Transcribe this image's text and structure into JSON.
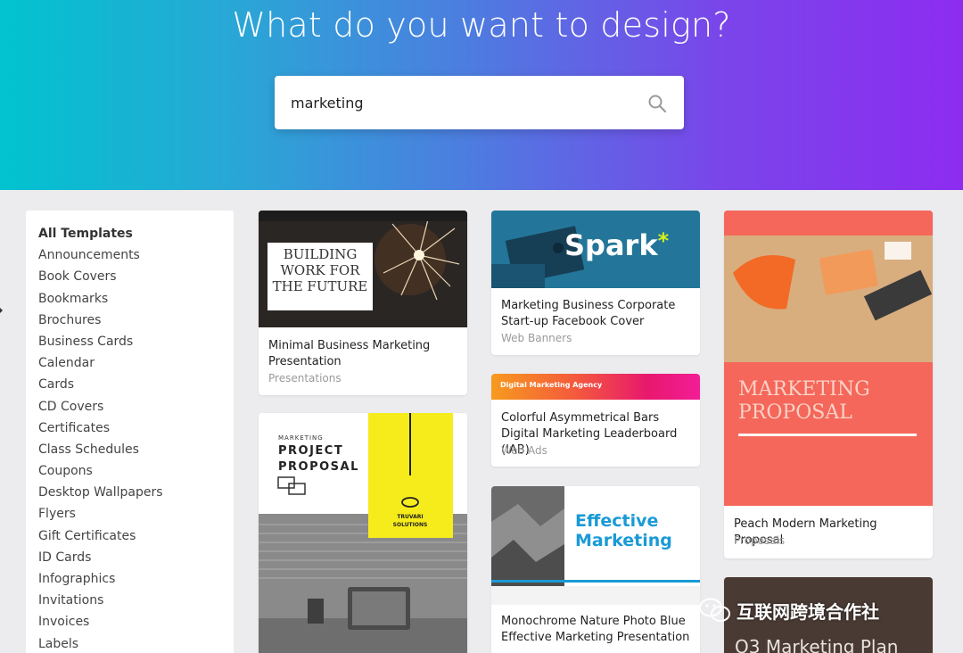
{
  "hero": {
    "title": "What do you want to design?"
  },
  "search": {
    "value": "marketing"
  },
  "sidebar": {
    "items": [
      {
        "label": "All Templates",
        "active": true
      },
      {
        "label": "Announcements"
      },
      {
        "label": "Book Covers"
      },
      {
        "label": "Bookmarks"
      },
      {
        "label": "Brochures"
      },
      {
        "label": "Business Cards"
      },
      {
        "label": "Calendar"
      },
      {
        "label": "Cards"
      },
      {
        "label": "CD Covers"
      },
      {
        "label": "Certificates"
      },
      {
        "label": "Class Schedules"
      },
      {
        "label": "Coupons"
      },
      {
        "label": "Desktop Wallpapers"
      },
      {
        "label": "Flyers"
      },
      {
        "label": "Gift Certificates"
      },
      {
        "label": "ID Cards"
      },
      {
        "label": "Infographics"
      },
      {
        "label": "Invitations"
      },
      {
        "label": "Invoices"
      },
      {
        "label": "Labels"
      }
    ]
  },
  "templates": {
    "minimal": {
      "title": "Minimal Business Marketing Presentation",
      "category": "Presentations",
      "thumb_text": "BUILDING WORK FOR THE FUTURE"
    },
    "project": {
      "thumb_kicker": "MARKETING",
      "thumb_title": "PROJECT PROPOSAL",
      "thumb_brand": "TRUVARI SOLUTIONS"
    },
    "spark": {
      "title": "Marketing Business Corporate Start-up Facebook Cover",
      "category": "Web Banners",
      "thumb_text": "Spark",
      "thumb_star": "*"
    },
    "colorful": {
      "title": "Colorful Asymmetrical Bars Digital Marketing Leaderboard (IAB)",
      "category": "Web Ads",
      "thumb_text": "Digital Marketing Agency"
    },
    "effective": {
      "title": "Monochrome Nature Photo Blue Effective Marketing Presentation",
      "thumb_text": "Effective Marketing"
    },
    "peach": {
      "title": "Peach Modern Marketing Proposal",
      "category": "Proposals",
      "thumb_text": "MARKETING PROPOSAL"
    },
    "q3": {
      "thumb_text": "Q3 Marketing Plan"
    }
  },
  "watermark": {
    "text": "互联网跨境合作社"
  },
  "colors": {
    "hero_start": "#01c3cf",
    "hero_end": "#8d2cf0",
    "spark_bg": "#1f6e92",
    "peach": "#f4675a",
    "effective_blue": "#1a9ad6",
    "yellow": "#f6ec1b"
  }
}
